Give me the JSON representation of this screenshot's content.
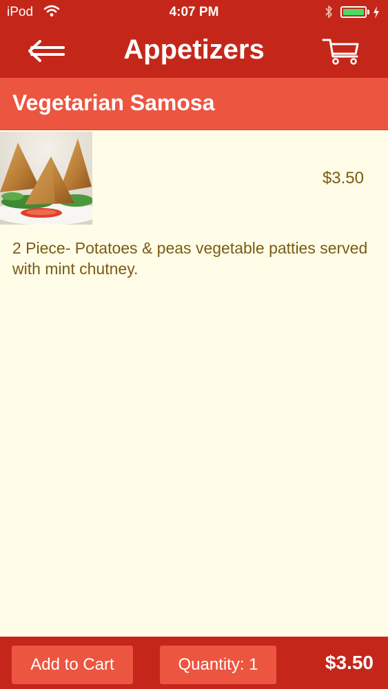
{
  "status_bar": {
    "carrier": "iPod",
    "time": "4:07 PM",
    "battery_level": 1.0,
    "wifi_icon": "wifi-icon",
    "bluetooth_icon": "bluetooth-icon",
    "charging_icon": "bolt-icon"
  },
  "nav": {
    "title": "Appetizers",
    "back_icon": "back-arrow-icon",
    "cart_icon": "cart-icon"
  },
  "item": {
    "name": "Vegetarian Samosa",
    "price": "$3.50",
    "description": "2 Piece- Potatoes & peas vegetable patties served with mint chutney."
  },
  "footer": {
    "add_to_cart_label": "Add to Cart",
    "quantity_label": "Quantity: 1",
    "total": "$3.50"
  },
  "colors": {
    "nav_bar": "#c4271a",
    "header_bar": "#ec5540",
    "button": "#ec5540",
    "background": "#fffde8",
    "text_brown": "#7a5b12",
    "battery": "#4cd964"
  }
}
